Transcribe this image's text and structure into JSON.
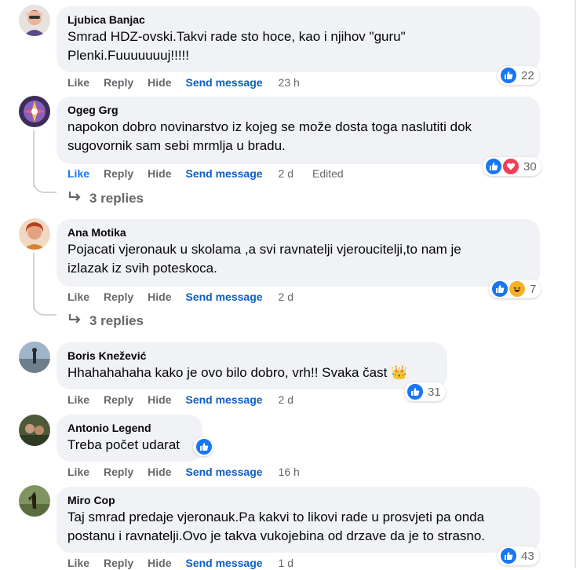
{
  "actions": {
    "like": "Like",
    "reply": "Reply",
    "hide": "Hide",
    "send": "Send message",
    "edited": "Edited"
  },
  "comments": [
    {
      "author": "Ljubica Banjac",
      "text": "Smrad HDZ-ovski.Takvi rade sto hoce, kao i njihov \"guru\"\nPlenki.Fuuuuuuuj!!!!!",
      "time": "23 h",
      "reactions": [
        "like-icon"
      ],
      "reaction_count": "22",
      "liked": false
    },
    {
      "author": "Ogeg Grg",
      "text": "napokon dobro novinarstvo iz kojeg se može dosta toga naslutiti dok\nsugovornik sam sebi mrmlja u bradu.",
      "time": "2 d",
      "edited": true,
      "reactions": [
        "like-icon",
        "love-icon"
      ],
      "reaction_count": "30",
      "liked": true,
      "replies": "3 replies"
    },
    {
      "author": "Ana Motika",
      "text": "Pojacati vjeronauk u skolama ,a svi ravnatelji vjeroucitelji,to nam je\nizlazak iz svih poteskoca.",
      "time": "2 d",
      "reactions": [
        "like-icon",
        "haha-icon"
      ],
      "reaction_count": "7",
      "liked": false,
      "replies": "3 replies"
    },
    {
      "author": "Boris Knežević",
      "text": "Hhahahahaha kako je ovo bilo dobro, vrh!! Svaka čast 👑",
      "time": "2 d",
      "reactions": [
        "like-icon"
      ],
      "reaction_count": "31",
      "liked": false
    },
    {
      "author": "Antonio Legend",
      "text": "Treba počet udarat",
      "time": "16 h",
      "reactions": [
        "like-icon"
      ],
      "reaction_count": "",
      "liked": false
    },
    {
      "author": "Miro Cop",
      "text": "Taj smrad predaje vjeronauk.Pa kakvi to likovi rade u prosvjeti pa onda\npostanu i ravnatelji.Ovo je takva vukojebina od drzave da je to strasno.",
      "time": "1 d",
      "reactions": [
        "like-icon"
      ],
      "reaction_count": "43",
      "liked": false
    }
  ]
}
